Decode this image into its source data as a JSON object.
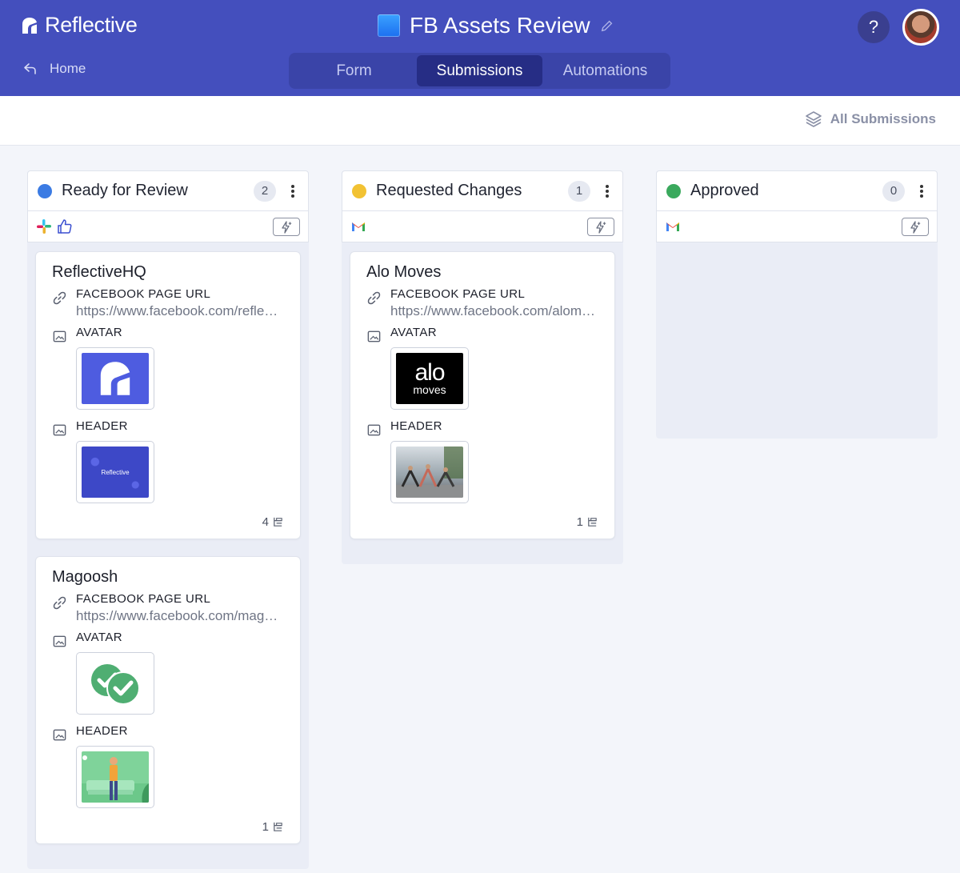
{
  "app": {
    "brand": "Reflective",
    "title": "FB Assets Review",
    "help_label": "?"
  },
  "nav": {
    "home_label": "Home"
  },
  "tabs": [
    {
      "label": "Form",
      "active": false
    },
    {
      "label": "Submissions",
      "active": true
    },
    {
      "label": "Automations",
      "active": false
    }
  ],
  "subbar": {
    "all_submissions_label": "All Submissions"
  },
  "colors": {
    "header_bg": "#444fbd",
    "ready": "#3b7be3",
    "requested": "#f2c233",
    "approved": "#3aa95d"
  },
  "columns": [
    {
      "title": "Ready for Review",
      "count": "2",
      "dot_color": "#3b7be3",
      "integrations": [
        "slack-icon",
        "thumbs-up-icon"
      ],
      "cards": [
        {
          "title": "ReflectiveHQ",
          "url_label": "FACEBOOK PAGE URL",
          "url_value": "https://www.facebook.com/reflectivehq",
          "avatar_label": "AVATAR",
          "header_label": "HEADER",
          "header_logo_text": "Reflective",
          "comments": "4"
        },
        {
          "title": "Magoosh",
          "url_label": "FACEBOOK PAGE URL",
          "url_value": "https://www.facebook.com/magoosh",
          "avatar_label": "AVATAR",
          "header_label": "HEADER",
          "comments": "1"
        }
      ]
    },
    {
      "title": "Requested Changes",
      "count": "1",
      "dot_color": "#f2c233",
      "integrations": [
        "gmail-icon"
      ],
      "cards": [
        {
          "title": "Alo Moves",
          "url_label": "FACEBOOK PAGE URL",
          "url_value": "https://www.facebook.com/alomoves",
          "avatar_label": "AVATAR",
          "avatar_logo_main": "alo",
          "avatar_logo_sub": "moves",
          "header_label": "HEADER",
          "comments": "1"
        }
      ]
    },
    {
      "title": "Approved",
      "count": "0",
      "dot_color": "#3aa95d",
      "integrations": [
        "gmail-icon"
      ],
      "cards": []
    }
  ]
}
